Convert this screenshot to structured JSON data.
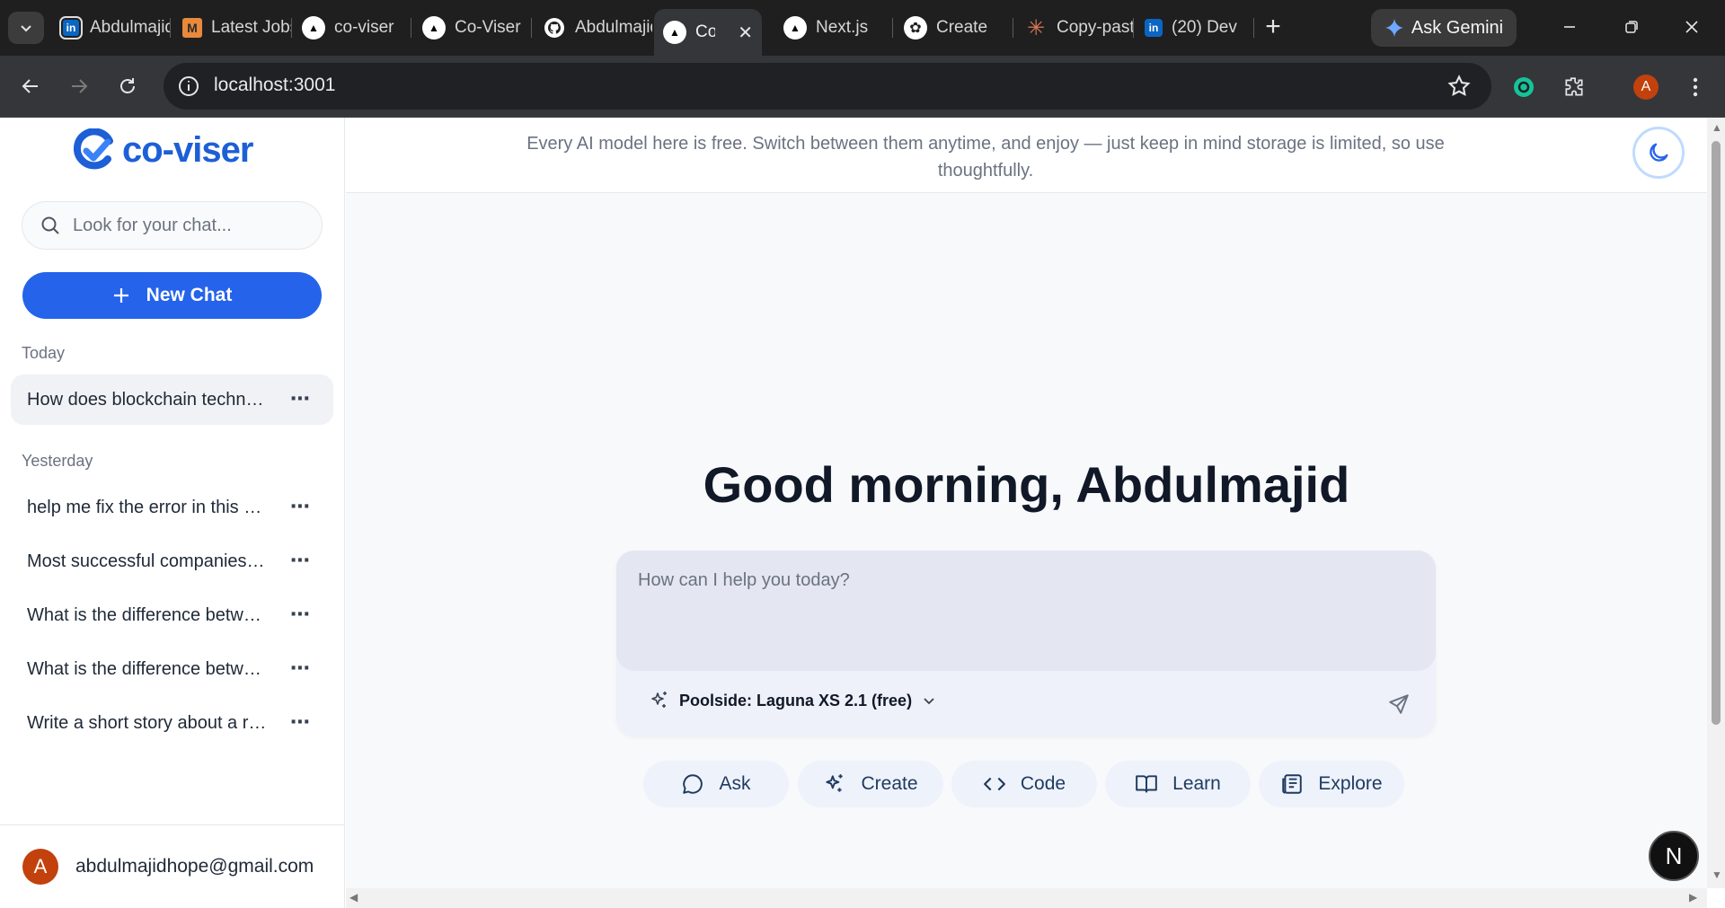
{
  "browser": {
    "tabs": [
      {
        "title": "Abdulmajid",
        "icon": "linkedin-icon",
        "favicon_glyph": "in",
        "favicon_color": "#0a66c2"
      },
      {
        "title": "Latest Jobs",
        "icon": "medium-icon",
        "favicon_glyph": "M",
        "favicon_color": "#e8893c"
      },
      {
        "title": "co-viser",
        "icon": "vercel-icon",
        "favicon_glyph": "▲",
        "favicon_color": "#000000"
      },
      {
        "title": "Co-Viser",
        "icon": "vercel-icon",
        "favicon_glyph": "▲",
        "favicon_color": "#000000"
      },
      {
        "title": "Abdulmajid",
        "icon": "github-icon",
        "favicon_glyph": "●",
        "favicon_color": "#ffffff"
      },
      {
        "title": "Co-Viser",
        "icon": "vercel-icon",
        "favicon_glyph": "▲",
        "favicon_color": "#000000",
        "active": true
      },
      {
        "title": "Next.js",
        "icon": "vercel-icon",
        "favicon_glyph": "▲",
        "favicon_color": "#000000"
      },
      {
        "title": "Create",
        "icon": "chatgpt-icon",
        "favicon_glyph": "✿",
        "favicon_color": "#ffffff"
      },
      {
        "title": "Copy-paste",
        "icon": "claude-icon",
        "favicon_glyph": "✳",
        "favicon_color": "#d97757"
      },
      {
        "title": "(20) Dev",
        "icon": "linkedin-icon",
        "favicon_glyph": "in",
        "favicon_color": "#0a66c2"
      }
    ],
    "ask_gemini": "Ask Gemini",
    "url": "localhost:3001",
    "profile_initial": "A"
  },
  "sidebar": {
    "brand": "co-viser",
    "search_placeholder": "Look for your chat...",
    "new_chat": "New Chat",
    "groups": [
      {
        "label": "Today",
        "chats": [
          "How does blockchain technology work?"
        ]
      },
      {
        "label": "Yesterday",
        "chats": [
          "help me fix the error in this code",
          "Most successful companies in the world",
          "What is the difference between AI and ML?",
          "What is the difference between React and Vue?",
          "Write a short story about a robot"
        ]
      }
    ],
    "user": {
      "initial": "A",
      "email": "abdulmajidhope@gmail.com"
    }
  },
  "main": {
    "banner": "Every AI model here is free. Switch between them anytime, and enjoy — just keep in mind storage is limited, so use thoughtfully.",
    "greeting": "Good morning, Abdulmajid",
    "composer_placeholder": "How can I help you today?",
    "model": "Poolside: Laguna XS 2.1 (free)",
    "actions": [
      {
        "label": "Ask",
        "icon": "chat-bubble-icon"
      },
      {
        "label": "Create",
        "icon": "sparkles-icon"
      },
      {
        "label": "Code",
        "icon": "code-brackets-icon"
      },
      {
        "label": "Learn",
        "icon": "book-icon"
      },
      {
        "label": "Explore",
        "icon": "newspaper-icon"
      }
    ],
    "nextjs_badge": "N"
  },
  "colors": {
    "accent": "#2563eb",
    "brand": "#1d5fd6",
    "avatar": "#c2410c"
  }
}
